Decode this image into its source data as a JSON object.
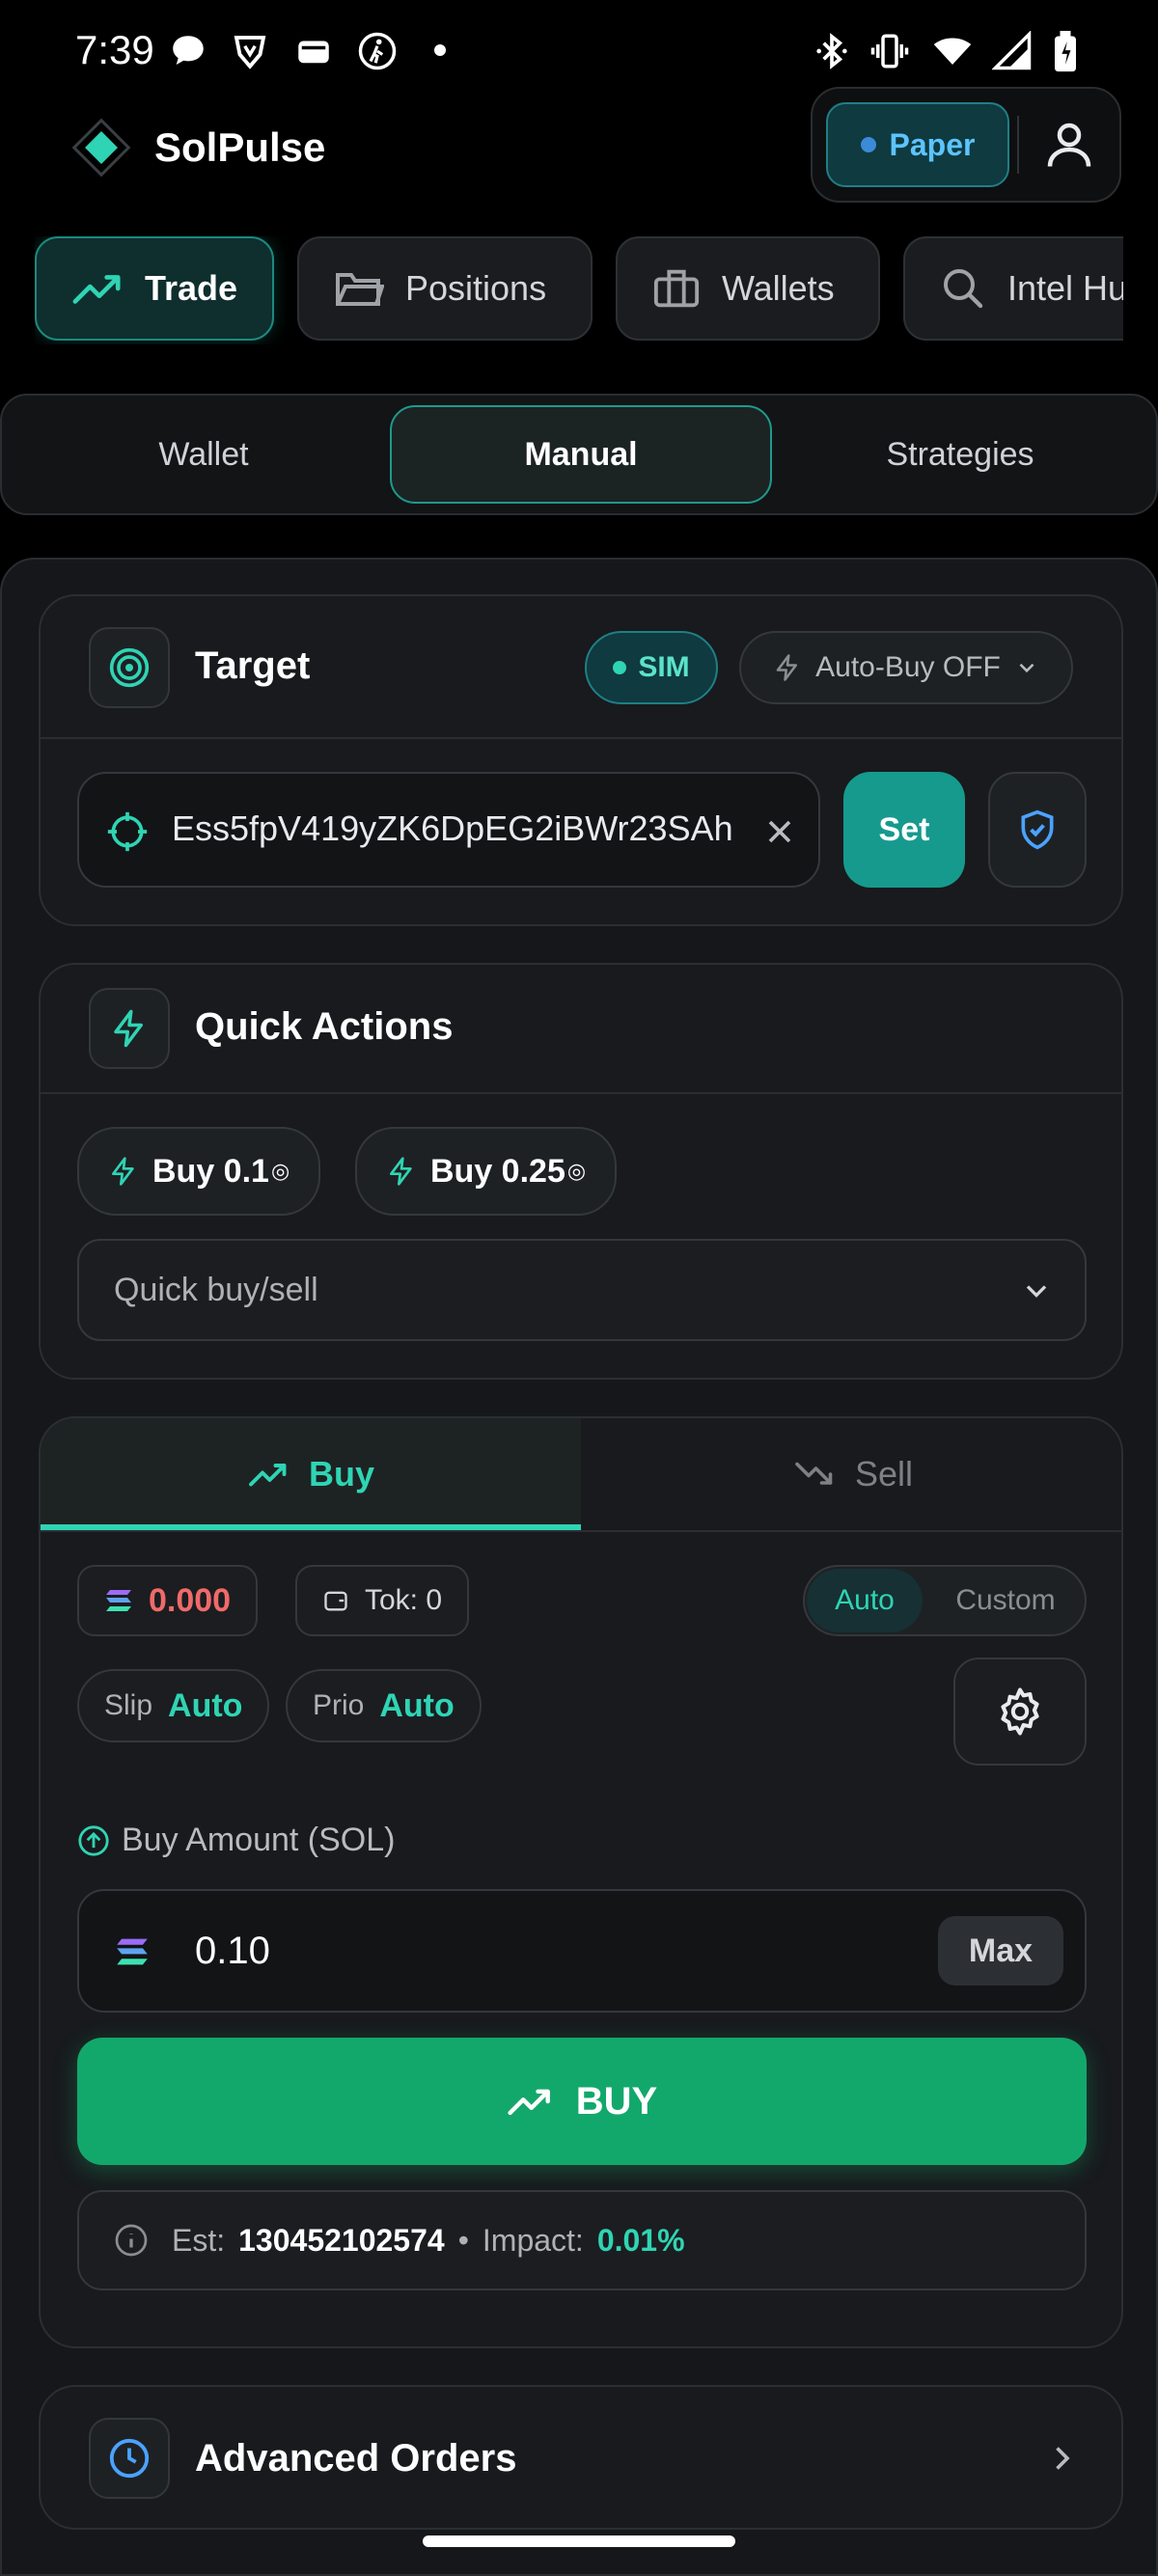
{
  "status_bar": {
    "time": "7:39"
  },
  "app": {
    "name": "SolPulse",
    "mode_badge": "Paper"
  },
  "nav_tabs": [
    {
      "label": "Trade",
      "icon": "trending-up-icon",
      "active": true
    },
    {
      "label": "Positions",
      "icon": "folder-icon"
    },
    {
      "label": "Wallets",
      "icon": "briefcase-icon"
    },
    {
      "label": "Intel Hu",
      "icon": "search-icon"
    }
  ],
  "sub_tabs": [
    {
      "label": "Wallet"
    },
    {
      "label": "Manual",
      "active": true
    },
    {
      "label": "Strategies"
    }
  ],
  "target": {
    "title": "Target",
    "sim_badge": "SIM",
    "auto_buy": "Auto-Buy OFF",
    "address": "Ess5fpV419yZK6DpEG2iBWr23SAh(",
    "set_label": "Set"
  },
  "quick_actions": {
    "title": "Quick Actions",
    "buttons": [
      {
        "label": "Buy 0.1",
        "unit": "◎"
      },
      {
        "label": "Buy 0.25",
        "unit": "◎"
      }
    ],
    "select_placeholder": "Quick buy/sell"
  },
  "trade": {
    "tabs": [
      {
        "label": "Buy",
        "active": true
      },
      {
        "label": "Sell"
      }
    ],
    "sol_balance": "0.000",
    "token_balance": "Tok: 0",
    "mode_options": [
      "Auto",
      "Custom"
    ],
    "mode_selected": "Auto",
    "slip_label": "Slip",
    "slip_value": "Auto",
    "prio_label": "Prio",
    "prio_value": "Auto",
    "amount_label": "Buy Amount (SOL)",
    "amount_value": "0.10",
    "max_label": "Max",
    "buy_label": "BUY",
    "est_label": "Est:",
    "est_value": "130452102574",
    "separator": "•",
    "impact_label": "Impact:",
    "impact_value": "0.01%"
  },
  "advanced": {
    "title": "Advanced Orders"
  },
  "colors": {
    "accent": "#2fd4b4",
    "buy_green": "#13a86b",
    "balance_red": "#f06a6a",
    "paper_blue": "#5cc4ff"
  }
}
